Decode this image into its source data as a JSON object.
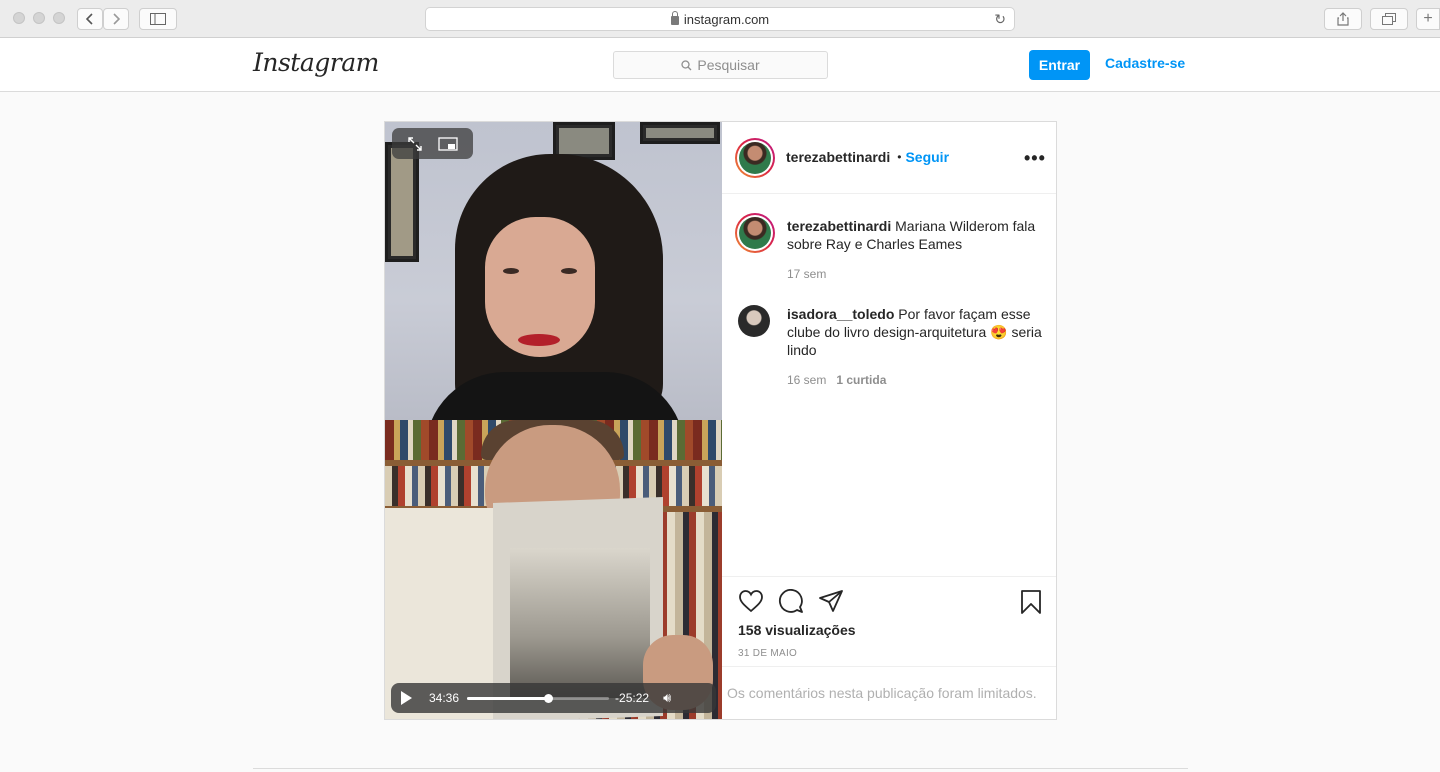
{
  "browser": {
    "url": "instagram.com"
  },
  "header": {
    "logo": "Instagram",
    "search_placeholder": "Pesquisar",
    "login_label": "Entrar",
    "signup_label": "Cadastre-se"
  },
  "post": {
    "author": "terezabettinardi",
    "separator": "•",
    "follow_label": "Seguir",
    "more_icon": "more-horizontal-icon",
    "video": {
      "elapsed": "34:36",
      "remaining": "-25:22",
      "progress": 0.57
    },
    "comments": [
      {
        "user": "terezabettinardi",
        "text": "Mariana Wilderom fala sobre Ray e Charles Eames",
        "time": "17 sem"
      },
      {
        "user": "isadora__toledo",
        "text": "Por favor façam esse clube do livro design-arquitetura 😍 seria lindo",
        "time": "16 sem",
        "likes": "1 curtida"
      }
    ],
    "views": "158 visualizações",
    "date": "31 DE MAIO",
    "comments_limited": "Os comentários nesta publicação foram limitados."
  },
  "colors": {
    "accent": "#0095f6",
    "border": "#dbdbdb",
    "background": "#fafafa"
  }
}
